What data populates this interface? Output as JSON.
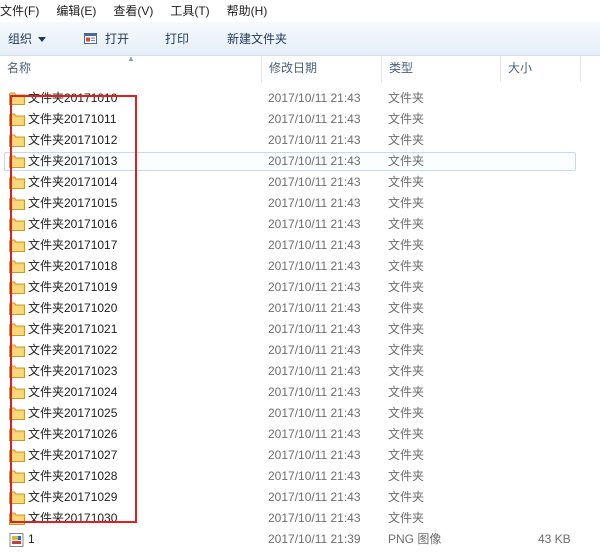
{
  "menubar": {
    "items": [
      "文件(F)",
      "编辑(E)",
      "查看(V)",
      "工具(T)",
      "帮助(H)"
    ]
  },
  "toolbar": {
    "organize_label": "组织",
    "open_label": "打开",
    "print_label": "打印",
    "new_folder_label": "新建文件夹"
  },
  "columns": {
    "name": "名称",
    "date_modified": "修改日期",
    "type": "类型",
    "size": "大小"
  },
  "colors": {
    "folder": "#e8b84a",
    "selection_border": "#c5d9f1",
    "annotation_box": "#e02020"
  },
  "files": [
    {
      "name": "文件夹20171010",
      "date": "2017/10/11 21:43",
      "type": "文件夹",
      "size": "",
      "icon": "folder-icon"
    },
    {
      "name": "文件夹20171011",
      "date": "2017/10/11 21:43",
      "type": "文件夹",
      "size": "",
      "icon": "folder-icon"
    },
    {
      "name": "文件夹20171012",
      "date": "2017/10/11 21:43",
      "type": "文件夹",
      "size": "",
      "icon": "folder-icon"
    },
    {
      "name": "文件夹20171013",
      "date": "2017/10/11 21:43",
      "type": "文件夹",
      "size": "",
      "icon": "folder-icon"
    },
    {
      "name": "文件夹20171014",
      "date": "2017/10/11 21:43",
      "type": "文件夹",
      "size": "",
      "icon": "folder-icon"
    },
    {
      "name": "文件夹20171015",
      "date": "2017/10/11 21:43",
      "type": "文件夹",
      "size": "",
      "icon": "folder-icon"
    },
    {
      "name": "文件夹20171016",
      "date": "2017/10/11 21:43",
      "type": "文件夹",
      "size": "",
      "icon": "folder-icon"
    },
    {
      "name": "文件夹20171017",
      "date": "2017/10/11 21:43",
      "type": "文件夹",
      "size": "",
      "icon": "folder-icon"
    },
    {
      "name": "文件夹20171018",
      "date": "2017/10/11 21:43",
      "type": "文件夹",
      "size": "",
      "icon": "folder-icon"
    },
    {
      "name": "文件夹20171019",
      "date": "2017/10/11 21:43",
      "type": "文件夹",
      "size": "",
      "icon": "folder-icon"
    },
    {
      "name": "文件夹20171020",
      "date": "2017/10/11 21:43",
      "type": "文件夹",
      "size": "",
      "icon": "folder-icon"
    },
    {
      "name": "文件夹20171021",
      "date": "2017/10/11 21:43",
      "type": "文件夹",
      "size": "",
      "icon": "folder-icon"
    },
    {
      "name": "文件夹20171022",
      "date": "2017/10/11 21:43",
      "type": "文件夹",
      "size": "",
      "icon": "folder-icon"
    },
    {
      "name": "文件夹20171023",
      "date": "2017/10/11 21:43",
      "type": "文件夹",
      "size": "",
      "icon": "folder-icon"
    },
    {
      "name": "文件夹20171024",
      "date": "2017/10/11 21:43",
      "type": "文件夹",
      "size": "",
      "icon": "folder-icon"
    },
    {
      "name": "文件夹20171025",
      "date": "2017/10/11 21:43",
      "type": "文件夹",
      "size": "",
      "icon": "folder-icon"
    },
    {
      "name": "文件夹20171026",
      "date": "2017/10/11 21:43",
      "type": "文件夹",
      "size": "",
      "icon": "folder-icon"
    },
    {
      "name": "文件夹20171027",
      "date": "2017/10/11 21:43",
      "type": "文件夹",
      "size": "",
      "icon": "folder-icon"
    },
    {
      "name": "文件夹20171028",
      "date": "2017/10/11 21:43",
      "type": "文件夹",
      "size": "",
      "icon": "folder-icon"
    },
    {
      "name": "文件夹20171029",
      "date": "2017/10/11 21:43",
      "type": "文件夹",
      "size": "",
      "icon": "folder-icon"
    },
    {
      "name": "文件夹20171030",
      "date": "2017/10/11 21:43",
      "type": "文件夹",
      "size": "",
      "icon": "folder-icon"
    },
    {
      "name": "1",
      "date": "2017/10/11 21:39",
      "type": "PNG 图像",
      "size": "43 KB",
      "icon": "png-image-icon"
    }
  ]
}
